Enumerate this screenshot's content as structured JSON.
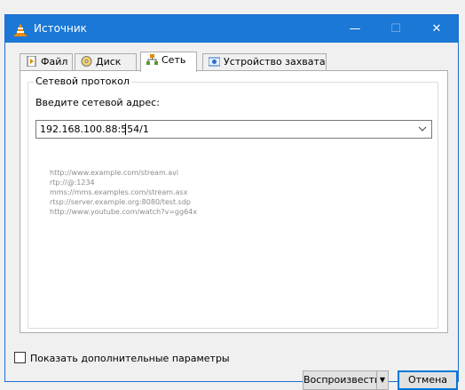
{
  "window": {
    "title": "Источник"
  },
  "titlebar_controls": {
    "minimize": "—",
    "maximize": "☐",
    "close": "✕"
  },
  "tabs": [
    {
      "label": "Файл",
      "icon": "file-icon"
    },
    {
      "label": "Диск",
      "icon": "disc-icon"
    },
    {
      "label": "Сеть",
      "icon": "network-icon",
      "active": true
    },
    {
      "label": "Устройство захвата",
      "icon": "capture-device-icon"
    }
  ],
  "network": {
    "group_title": "Сетевой протокол",
    "address_label": "Введите сетевой адрес:",
    "address_value": "192.168.100.88:554/1",
    "examples": [
      "http://www.example.com/stream.avi",
      "rtp://@:1234",
      "mms://mms.examples.com/stream.asx",
      "rtsp://server.example.org:8080/test.sdp",
      "http://www.youtube.com/watch?v=gg64x"
    ]
  },
  "options": {
    "show_more_label": "Показать дополнительные параметры",
    "checked": false
  },
  "buttons": {
    "play": "Воспроизвести",
    "play_dropdown": "▼",
    "cancel": "Отмена"
  },
  "colors": {
    "titlebar": "#1b78d6",
    "focus_border": "#0078d7"
  }
}
